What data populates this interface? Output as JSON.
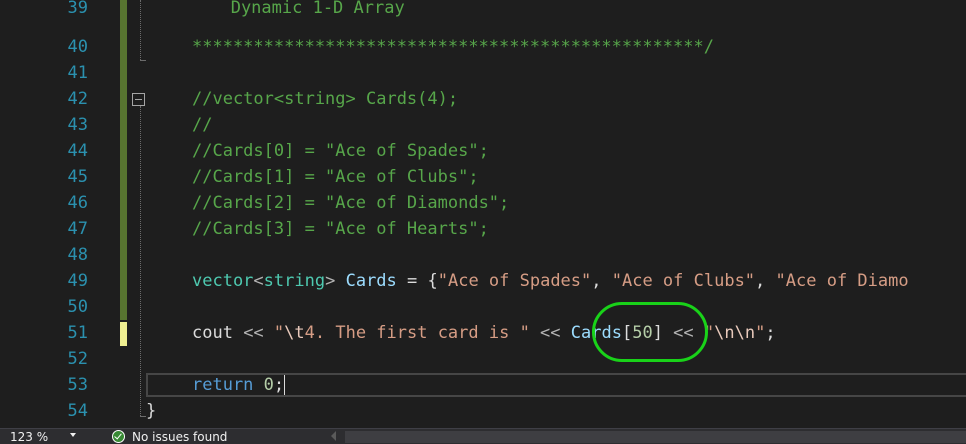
{
  "editor": {
    "line_numbers": [
      "39",
      "40",
      "41",
      "42",
      "43",
      "44",
      "45",
      "46",
      "47",
      "48",
      "49",
      "50",
      "51",
      "52",
      "53",
      "54"
    ],
    "lines": {
      "l39": "   Dynamic 1-D Array",
      "l40": "**************************************************/",
      "l42": "//vector<string> Cards(4);",
      "l43": "//",
      "l44": "//Cards[0] = \"Ace of Spades\";",
      "l45": "//Cards[1] = \"Ace of Clubs\";",
      "l46": "//Cards[2] = \"Ace of Diamonds\";",
      "l47": "//Cards[3] = \"Ace of Hearts\";",
      "l49": {
        "type": "vector",
        "lt": "<",
        "inner": "string",
        "gt": ">",
        "var": "Cards",
        "eq": " = {",
        "s1": "\"Ace of Spades\"",
        "c1": ", ",
        "s2": "\"Ace of Clubs\"",
        "c2": ", ",
        "s3": "\"Ace of Diamo"
      },
      "l51": {
        "cout": "cout",
        "op1": " << ",
        "str1_q": "\"",
        "str1_esc": "\\t",
        "str1_rest": "4. The first card is \"",
        "op2": " << ",
        "var": "Cards",
        "br_open": "[",
        "num": "50",
        "br_close": "]",
        "op3": " << ",
        "str2_q1": "\"",
        "str2_esc": "\\n\\n",
        "str2_q2": "\"",
        "semi": ";"
      },
      "l53": {
        "kw": "return",
        "num": " 0",
        "semi": ";"
      },
      "l54": "}"
    }
  },
  "statusbar": {
    "zoom": "123 %",
    "issues": "No issues found"
  },
  "colors": {
    "highlight_circle": "#19d219",
    "comment": "#57a64a",
    "keyword": "#569cd6",
    "type": "#4ec9b0",
    "string": "#d69d85"
  }
}
